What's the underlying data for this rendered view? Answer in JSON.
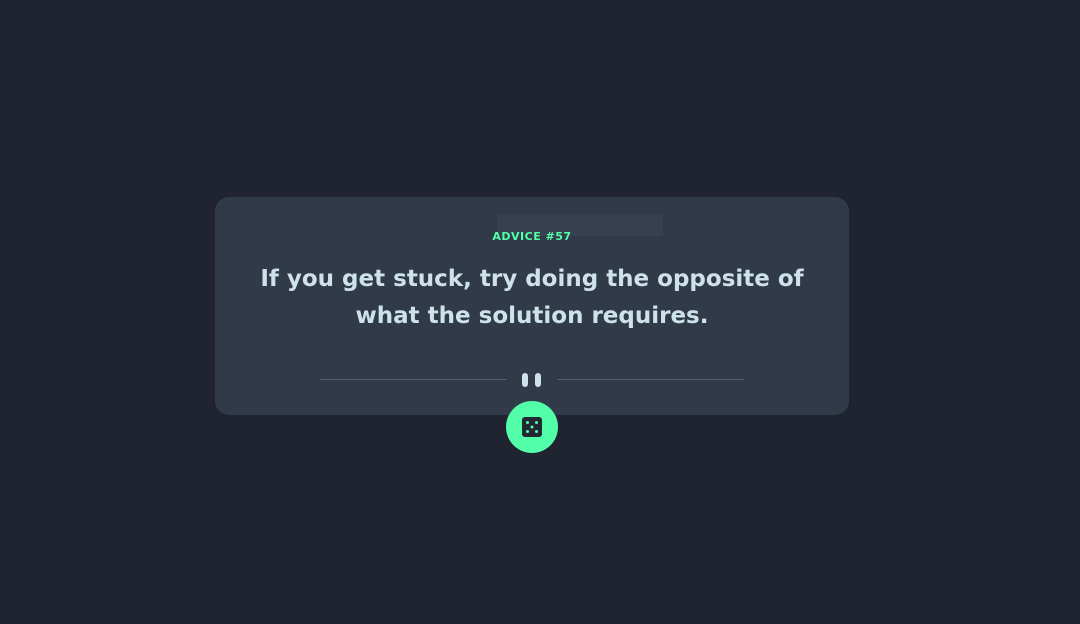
{
  "card": {
    "advice_label": "ADVICE #57",
    "advice_text": "If you get stuck, try doing the opposite of what the solution requires."
  },
  "divider": {
    "icon": "pause-icon"
  },
  "dice_button": {
    "icon": "dice-icon"
  },
  "colors": {
    "background": "#202431",
    "card": "#313a48",
    "accent": "#52ffa8",
    "text": "#cee3e9",
    "divider": "#4f5d74"
  }
}
